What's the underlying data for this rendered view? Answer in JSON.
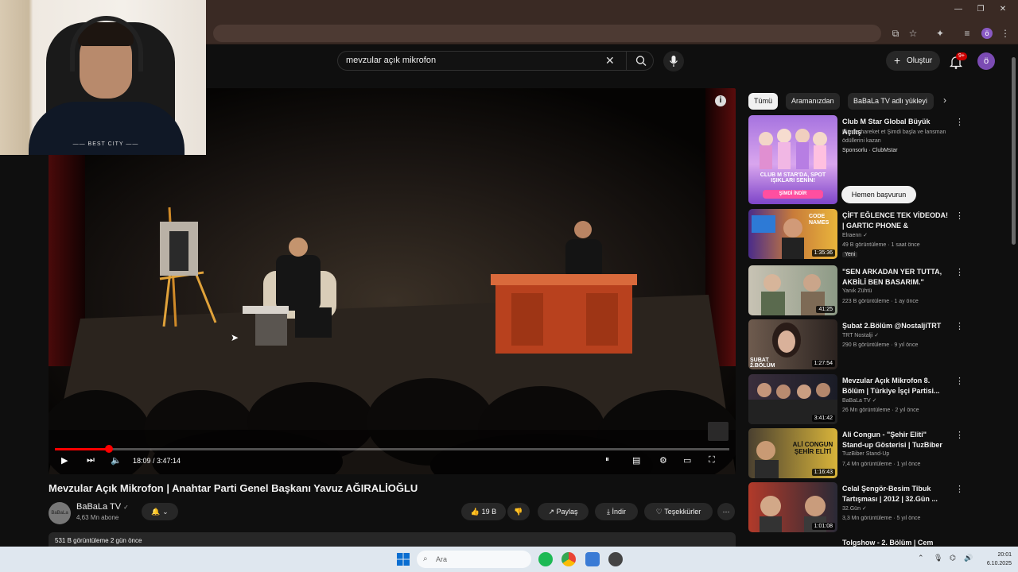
{
  "search": {
    "query": "mevzular açık mikrofon",
    "clear_icon": "close-icon",
    "search_icon": "search-icon",
    "mic_icon": "mic-icon"
  },
  "header": {
    "create_label": "Oluştur",
    "notifications_badge": "9+",
    "avatar_letter": "ö"
  },
  "webcam": {
    "shirt_text": "—— BEST CITY ——"
  },
  "player": {
    "time": "18:09 / 3:47:14",
    "progress_fraction": 0.08,
    "info_icon": "i"
  },
  "video": {
    "title": "Mevzular Açık Mikrofon | Anahtar Parti Genel Başkanı Yavuz AĞIRALİOĞLU",
    "channel": "BaBaLa TV",
    "verified_mark": "✓",
    "subscribers": "4,63 Mn abone",
    "avatar_text": "BaBaLa",
    "likes": "19 B",
    "share": "Paylaş",
    "download": "İndir",
    "thanks": "Teşekkürler",
    "more": "⋯",
    "description_line": "531 B görüntüleme  2 gün önce"
  },
  "chips": [
    "Tümü",
    "Aramanızdan",
    "BaBaLa TV adlı yükleyi"
  ],
  "ad": {
    "title": "Club M Star Global Büyük Açılış",
    "desc": "Ritimle hareket et Şimdi başla ve lansman ödüllerini kazan",
    "sponsor": "Sponsorlu · ClubMstar",
    "thumb_text": "CLUB M STAR'DA, SPOT IŞIKLARI SENİN!",
    "thumb_cta": "ŞİMDİ İNDİR",
    "apply_label": "Hemen başvurun"
  },
  "recommendations": [
    {
      "title": "ÇİFT EĞLENCE TEK VİDEODA! | GARTIC PHONE & CODENAME...",
      "channel": "Elraenn ✓",
      "meta": "49 B görüntüleme · 1 saat önce",
      "duration": "1:35:36",
      "badge": "Yeni"
    },
    {
      "title": "\"SEN ARKADAN YER TUTTA, AKBİLİ BEN BASARIM.\"",
      "channel": "Yanık Zühtü",
      "meta": "223 B görüntüleme · 1 ay önce",
      "duration": "41:25",
      "badge": ""
    },
    {
      "title": "Şubat 2.Bölüm @NostaljiTRT",
      "channel": "TRT Nostalji ✓",
      "meta": "290 B görüntüleme · 9 yıl önce",
      "duration": "1:27:54",
      "badge": ""
    },
    {
      "title": "Mevzular Açık Mikrofon 8. Bölüm | Türkiye İşçi Partisi...",
      "channel": "BaBaLa TV ✓",
      "meta": "26 Mn görüntüleme · 2 yıl önce",
      "duration": "3:41:42",
      "badge": ""
    },
    {
      "title": "Ali Congun - \"Şehir Eliti\" Stand-up Gösterisi | TuzBiber Stand-...",
      "channel": "TuzBiber Stand-Up",
      "meta": "7,4 Mn görüntüleme · 1 yıl önce",
      "duration": "1:16:43",
      "badge": ""
    },
    {
      "title": "Celal Şengör-Besim Tibuk Tartışması | 2012 | 32.Gün ...",
      "channel": "32.Gün ✓",
      "meta": "3,3 Mn görüntüleme · 5 yıl önce",
      "duration": "1:01:08",
      "badge": ""
    },
    {
      "title": "Tolgshow - 2. Bölüm | Cem",
      "channel": "",
      "meta": "",
      "duration": "",
      "badge": ""
    }
  ],
  "thumb_texts": {
    "gartic": "CODE NAMES",
    "trt": "ŞUBAT 2.BÖLÜM",
    "ali": "ALİ CONGUN ŞEHİR ELİTİ"
  },
  "taskbar": {
    "search_placeholder": "Ara",
    "time": "20:01",
    "date": "6.10.2025"
  },
  "colors": {
    "accent": "#ff0000",
    "background": "#0f0f0f",
    "chrome": "#3a2a24"
  }
}
